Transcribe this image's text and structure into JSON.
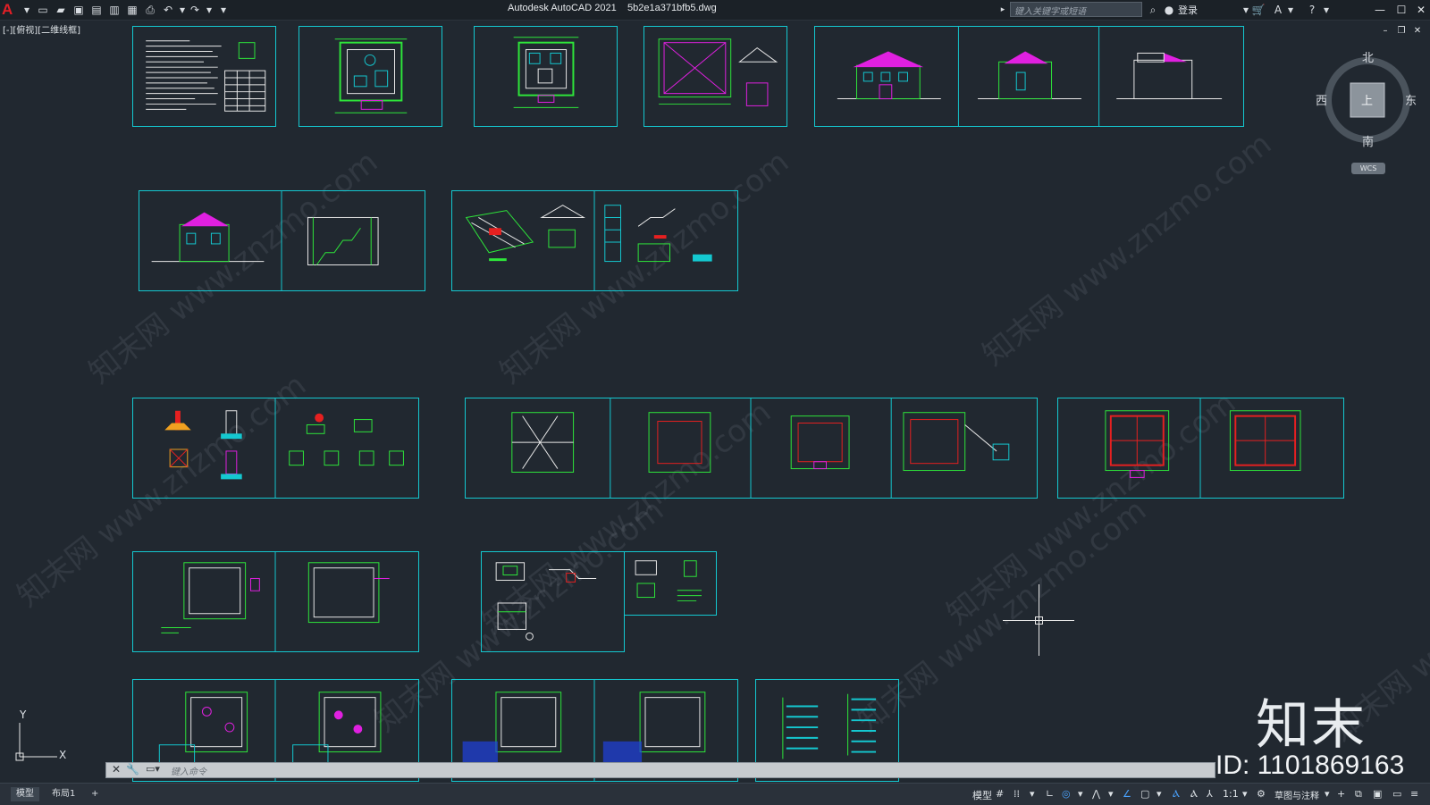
{
  "app": {
    "logo": "A",
    "title": "Autodesk AutoCAD 2021",
    "file": "5b2e1a371bfb5.dwg",
    "search_placeholder": "键入关键字或短语",
    "login": "登录"
  },
  "viewport": {
    "label": "[-][俯视][二维线框]"
  },
  "viewcube": {
    "north": "北",
    "south": "南",
    "east": "东",
    "west": "西",
    "face": "上",
    "wcs": "WCS"
  },
  "watermark": {
    "text": "知末网 www.znzmo.com"
  },
  "brand": {
    "logo_text": "知末",
    "id_text": "ID: 1101869163"
  },
  "ucs": {
    "x": "X",
    "y": "Y"
  },
  "command": {
    "placeholder": "键入命令"
  },
  "layout_tabs": [
    "模型",
    "布局1",
    "+"
  ],
  "status": {
    "model": "模型",
    "scale": "1:1",
    "workspace": "草图与注释"
  },
  "colors": {
    "sheet_border": "#14c8d0",
    "green": "#2ee63a",
    "magenta": "#e020e0",
    "red": "#e62020",
    "blue": "#2040e0",
    "white": "#e8e8e8"
  }
}
